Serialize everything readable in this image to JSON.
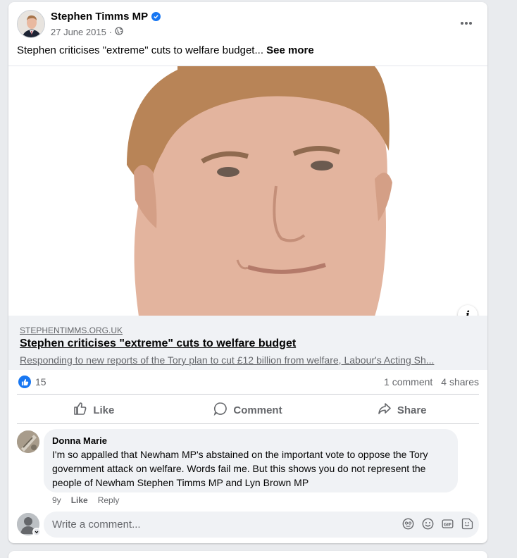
{
  "post": {
    "author": "Stephen Timms MP",
    "date": "27 June 2015",
    "separator": "·",
    "text": "Stephen criticises \"extreme\" cuts to welfare budget...",
    "see_more": "See more"
  },
  "link": {
    "domain": "STEPHENTIMMS.ORG.UK",
    "title": "Stephen criticises \"extreme\" cuts to welfare budget",
    "description": "Responding to new reports of the Tory plan to cut £12 billion from welfare, Labour's Acting Sh..."
  },
  "stats": {
    "reactions_count": "15",
    "comments": "1 comment",
    "shares": "4 shares"
  },
  "actions": {
    "like": "Like",
    "comment": "Comment",
    "share": "Share"
  },
  "comment": {
    "author": "Donna Marie",
    "text": "I'm so appalled that Newham MP's abstained on the important vote to oppose the Tory government attack on welfare. Words fail me. But this shows you do not represent the people of Newham Stephen Timms MP and Lyn Brown MP",
    "age": "9y",
    "like": "Like",
    "reply": "Reply"
  },
  "composer": {
    "placeholder": "Write a comment..."
  },
  "icons": {
    "verified": "verified-badge-icon",
    "privacy": "globe-icon",
    "more": "more-options-icon",
    "info": "info-icon",
    "like": "thumbs-up-icon",
    "comment": "comment-bubble-icon",
    "share": "share-arrow-icon",
    "avatar_sticker": "avatar-sticker-icon",
    "emoji": "emoji-icon",
    "gif": "gif-icon",
    "sticker": "sticker-icon"
  },
  "colors": {
    "accent": "#1877f2",
    "secondary_text": "#65676b",
    "surface": "#f0f2f5"
  }
}
